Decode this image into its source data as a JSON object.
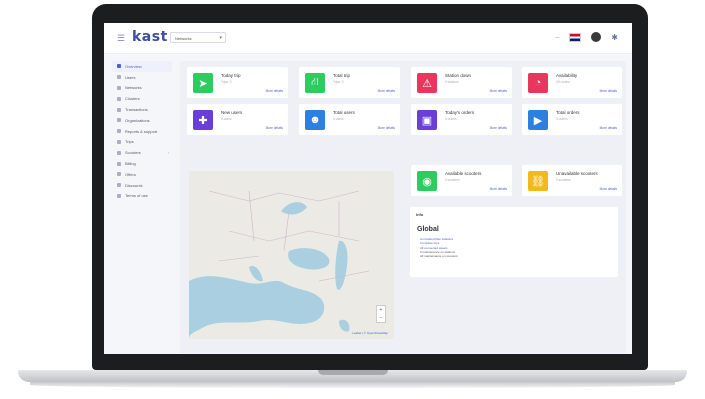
{
  "header": {
    "logo": "kast",
    "selector_value": "Networks",
    "menu_icon": "hamburger-icon",
    "icons": [
      "language-flag-icon",
      "user-avatar-icon",
      "settings-icon"
    ]
  },
  "sidebar": {
    "items": [
      {
        "label": "Overview",
        "active": true
      },
      {
        "label": "Users"
      },
      {
        "label": "Networks"
      },
      {
        "label": "Clusters"
      },
      {
        "label": "Transactions"
      },
      {
        "label": "Organizations"
      },
      {
        "label": "Reports & support"
      },
      {
        "label": "Trips"
      },
      {
        "label": "Scooters",
        "has_children": true
      },
      {
        "label": "Billing"
      },
      {
        "label": "Offers"
      },
      {
        "label": "Discounts"
      },
      {
        "label": "Terms of use"
      }
    ]
  },
  "cards": [
    {
      "title": "Today trip",
      "sub": "Trips: 0",
      "more": "More details",
      "color": "#2ecc5e",
      "icon": "navigation-arrow-icon"
    },
    {
      "title": "Total trip",
      "sub": "Trips: 0",
      "more": "More details",
      "color": "#2ecc5e",
      "icon": "road-icon"
    },
    {
      "title": "Station down",
      "sub": "0 stations",
      "more": "More details",
      "color": "#e8365d",
      "icon": "warning-icon"
    },
    {
      "title": "Availability",
      "sub": "0% online",
      "more": "More details",
      "color": "#e8365d",
      "icon": "speedometer-icon"
    },
    {
      "title": "New users",
      "sub": "0 users",
      "more": "More details",
      "color": "#6a3fd8",
      "icon": "add-user-icon"
    },
    {
      "title": "Total users",
      "sub": "0 users",
      "more": "More details",
      "color": "#2d7fe0",
      "icon": "users-group-icon"
    },
    {
      "title": "Today's orders",
      "sub": "0 orders",
      "more": "More details",
      "color": "#6a3fd8",
      "icon": "shopping-bag-icon"
    },
    {
      "title": "Total orders",
      "sub": "0 orders",
      "more": "More details",
      "color": "#2d7fe0",
      "icon": "video-play-icon"
    },
    {
      "title": "Available scooters",
      "sub": "0 scooters",
      "more": "More details",
      "color": "#2ecc5e",
      "icon": "play-circle-icon"
    },
    {
      "title": "Unavailable scooters",
      "sub": "0 scooters",
      "more": "More details",
      "color": "#f3b81c",
      "icon": "broken-link-icon"
    }
  ],
  "map": {
    "zoom_in": "+",
    "zoom_out": "−",
    "attribution": "Leaflet | © OpenStreetMap"
  },
  "info": {
    "header": "Info",
    "title": "Global",
    "links": [
      "Cumulated bike statistics",
      "Complete trips",
      "All connected assets"
    ],
    "plain": [
      "0 maintenance on stations",
      "All maintenance on scooters"
    ]
  }
}
